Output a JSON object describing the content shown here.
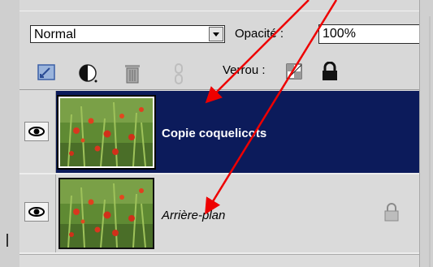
{
  "blend_mode": "Normal",
  "opacity": {
    "label": "Opacité :",
    "value": "100%"
  },
  "toolbar": {
    "icons": [
      "new-layer-icon",
      "adjustment-icon",
      "trash-icon",
      "link-icon"
    ],
    "lock_label": "Verrou :",
    "lock_icons": [
      "lock-transparency-icon",
      "lock-all-icon"
    ]
  },
  "layers": [
    {
      "name": "Copie coquelicots",
      "visible": true,
      "selected": true,
      "icons": [
        "eye-icon"
      ]
    },
    {
      "name": "Arrière-plan",
      "visible": true,
      "selected": false,
      "locked": true,
      "icons": [
        "eye-icon",
        "padlock-icon"
      ]
    }
  ],
  "colors": {
    "selection": "#0c1b5b",
    "arrow": "#ee0000",
    "panel": "#d8d8d8"
  }
}
